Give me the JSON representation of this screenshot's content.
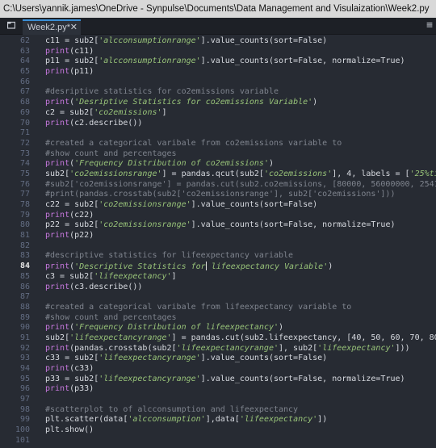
{
  "window": {
    "title": "C:\\Users\\yannik.james\\OneDrive - Synpulse\\Documents\\Data Management and Visulaization\\Week2.py"
  },
  "tabs": [
    {
      "label": "Week2.py*",
      "close": "✕"
    }
  ],
  "icons": {
    "new_tab": "folder-icon",
    "menu": "hamburger-menu-icon"
  },
  "editor": {
    "active_line": 84,
    "lines": [
      {
        "n": "62",
        "t": "c11 = sub2['alcconsumptionrange'].value_counts(sort=False)"
      },
      {
        "n": "63",
        "t": "print(c11)"
      },
      {
        "n": "64",
        "t": "p11 = sub2['alcconsumptionrange'].value_counts(sort=False, normalize=True)"
      },
      {
        "n": "65",
        "t": "print(p11)"
      },
      {
        "n": "66",
        "t": ""
      },
      {
        "n": "67",
        "t": "#desriptive statistics for co2emissions variable"
      },
      {
        "n": "68",
        "t": "print('Desriptive Statistics for co2emissions Variable')"
      },
      {
        "n": "69",
        "t": "c2 = sub2['co2emissions']"
      },
      {
        "n": "70",
        "t": "print(c2.describe())"
      },
      {
        "n": "71",
        "t": ""
      },
      {
        "n": "72",
        "t": "#created a categorical varibale from co2emissions variable to"
      },
      {
        "n": "73",
        "t": "#show count and percentages"
      },
      {
        "n": "74",
        "t": "print('Frequency Distribution of co2emissions')"
      },
      {
        "n": "75",
        "t": "sub2['co2emissionsrange'] = pandas.qcut(sub2['co2emissions'], 4, labels = ['25%tile"
      },
      {
        "n": "76",
        "t": "#sub2['co2emissionsrange'] = pandas.cut(sub2.co2emissions, [80000, 56000000, 254100"
      },
      {
        "n": "77",
        "t": "#print(pandas.crosstab(sub2['co2emissionsrange'], sub2['co2emissions']))"
      },
      {
        "n": "78",
        "t": "c22 = sub2['co2emissionsrange'].value_counts(sort=False)"
      },
      {
        "n": "79",
        "t": "print(c22)"
      },
      {
        "n": "80",
        "t": "p22 = sub2['co2emissionsrange'].value_counts(sort=False, normalize=True)"
      },
      {
        "n": "81",
        "t": "print(p22)"
      },
      {
        "n": "82",
        "t": ""
      },
      {
        "n": "83",
        "t": "#descriptive statistics for lifeexpectancy variable"
      },
      {
        "n": "84",
        "t": "print('Descriptive Statistics for lifeexpectancy Variable')"
      },
      {
        "n": "85",
        "t": "c3 = sub2['lifeexpectancy']"
      },
      {
        "n": "86",
        "t": "print(c3.describe())"
      },
      {
        "n": "87",
        "t": ""
      },
      {
        "n": "88",
        "t": "#created a categorical varibale from lifeexpectancy variable to"
      },
      {
        "n": "89",
        "t": "#show count and percentages"
      },
      {
        "n": "90",
        "t": "print('Frequency Distribution of lifeexpectancy')"
      },
      {
        "n": "91",
        "t": "sub2['lifeexpectancyrange'] = pandas.cut(sub2.lifeexpectancy, [40, 50, 60, 70, 80,"
      },
      {
        "n": "92",
        "t": "print(pandas.crosstab(sub2['lifeexpectancyrange'], sub2['lifeexpectancy']))"
      },
      {
        "n": "93",
        "t": "c33 = sub2['lifeexpectancyrange'].value_counts(sort=False)"
      },
      {
        "n": "94",
        "t": "print(c33)"
      },
      {
        "n": "95",
        "t": "p33 = sub2['lifeexpectancyrange'].value_counts(sort=False, normalize=True)"
      },
      {
        "n": "96",
        "t": "print(p33)"
      },
      {
        "n": "97",
        "t": ""
      },
      {
        "n": "98",
        "t": "#scatterplot to of alcconsumption and lifeexpectancy"
      },
      {
        "n": "99",
        "t": "plt.scatter(data['alcconsumption'],data['lifeexpectancy'])"
      },
      {
        "n": "100",
        "t": "plt.show()"
      },
      {
        "n": "101",
        "t": ""
      }
    ]
  },
  "colors": {
    "background": "#272b33",
    "keyword": "#c678dd",
    "string": "#98c379",
    "comment": "#7f848e",
    "text": "#d7dae0",
    "line_number": "#636d83",
    "tab_accent": "#3a8fd6"
  }
}
